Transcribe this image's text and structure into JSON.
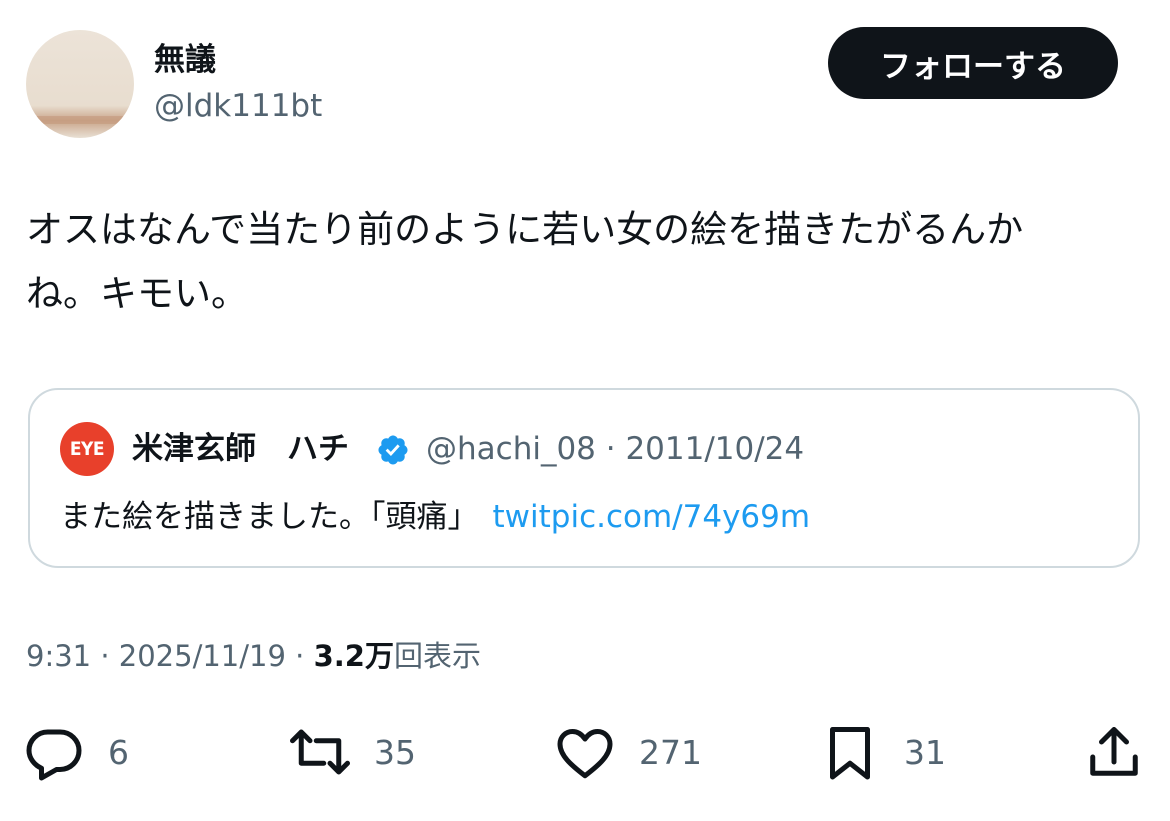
{
  "author": {
    "display_name": "無議",
    "handle": "@ldk111bt",
    "avatar_icon": "profile-avatar"
  },
  "follow_button": {
    "label": "フォローする"
  },
  "tweet": {
    "text_lines": [
      "オスはなんで当たり前のように若い女の絵を描きたがるんか",
      "ね。キモい。"
    ]
  },
  "quote": {
    "avatar_text": "EYE",
    "name": "米津玄師　ハチ",
    "verified_icon": "verified-badge-icon",
    "handle_date": "@hachi_08 · 2011/10/24",
    "text": "また絵を描きました。「頭痛」",
    "link": "twitpic.com/74y69m"
  },
  "meta": {
    "time_date": "9:31 · 2025/11/19 · ",
    "views_count": "3.2万",
    "views_label": "回表示"
  },
  "actions": {
    "reply": {
      "icon": "reply-icon",
      "count": "6"
    },
    "retweet": {
      "icon": "retweet-icon",
      "count": "35"
    },
    "like": {
      "icon": "heart-icon",
      "count": "271"
    },
    "bookmark": {
      "icon": "bookmark-icon",
      "count": "31"
    },
    "share": {
      "icon": "share-icon"
    }
  },
  "colors": {
    "text": "#0f1419",
    "secondary": "#536471",
    "link": "#1d9bf0",
    "border": "#cfd9de",
    "button_bg": "#0f1419"
  }
}
